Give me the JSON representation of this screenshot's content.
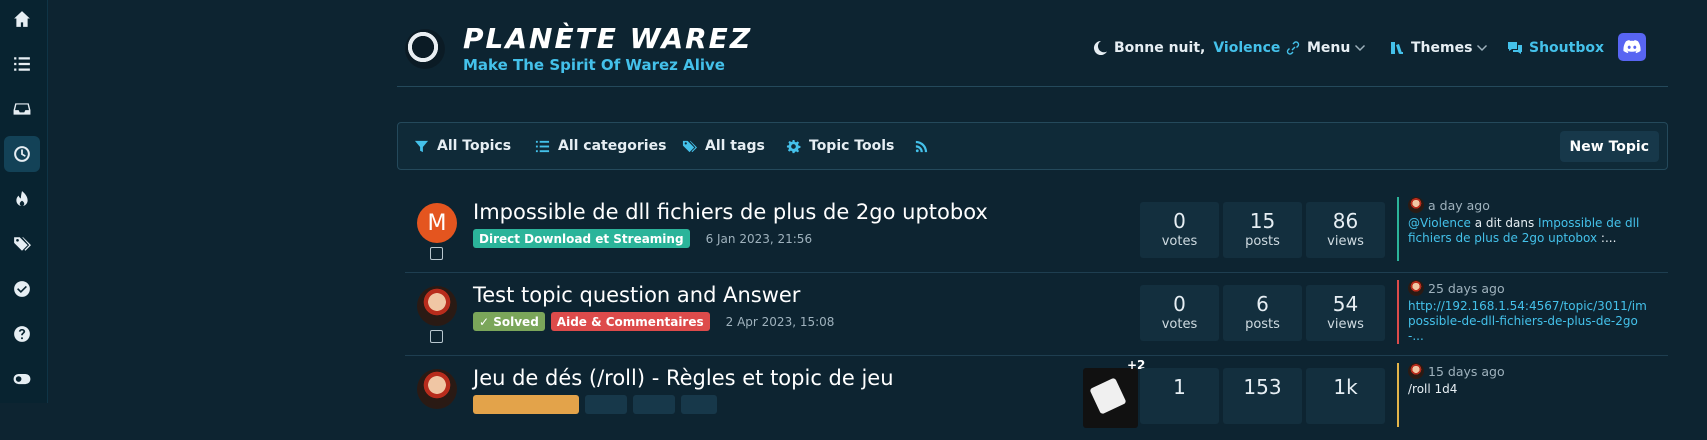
{
  "rail": {
    "items": [
      {
        "icon": "home-icon",
        "active": false
      },
      {
        "icon": "list-icon",
        "active": false
      },
      {
        "icon": "inbox-icon",
        "active": false
      },
      {
        "icon": "clock-icon",
        "active": true
      },
      {
        "icon": "fire-icon",
        "active": false
      },
      {
        "icon": "tags-icon",
        "active": false
      },
      {
        "icon": "check-circle-icon",
        "active": false
      },
      {
        "icon": "help-icon",
        "active": false
      },
      {
        "icon": "toggle-icon",
        "active": false
      }
    ]
  },
  "brand": {
    "title": "PLANÈTE WAREZ",
    "subtitle": "Make The Spirit Of Warez Alive"
  },
  "header": {
    "greeting": "Bonne nuit,",
    "username": "Violence",
    "menu": "Menu",
    "themes": "Themes",
    "shoutbox": "Shoutbox"
  },
  "toolbar": {
    "all_topics": "All Topics",
    "all_categories": "All categories",
    "all_tags": "All tags",
    "topic_tools": "Topic Tools",
    "new_topic": "New Topic"
  },
  "topics": [
    {
      "title": "Impossible de dll fichiers de plus de 2go uptobox",
      "avatar_letter": "M",
      "tags": [
        {
          "label": "Direct Download et Streaming",
          "color": "#2bb49a"
        }
      ],
      "date": "6 Jan 2023, 21:56",
      "votes": "0",
      "posts": "15",
      "views": "86",
      "stat_labels": {
        "votes": "votes",
        "posts": "posts",
        "views": "views"
      },
      "last_ago": "a day ago",
      "last_user": "@Violence",
      "last_mid": " a dit dans ",
      "last_link": "Impossible de dll fichiers de plus de 2go uptobox",
      "last_tail": " :...",
      "border": "#2bb49a"
    },
    {
      "title": "Test topic question and Answer",
      "tags": [
        {
          "label": "✓ Solved",
          "color": "#7ba65a"
        },
        {
          "label": "Aide & Commentaires",
          "color": "#dd4b4b"
        }
      ],
      "date": "2 Apr 2023, 15:08",
      "votes": "0",
      "posts": "6",
      "views": "54",
      "last_ago": "25 days ago",
      "last_link": "http://192.168.1.54:4567/topic/3011/impossible-de-dll-fichiers-de-plus-de-2go-...",
      "border": "#dd4b4b"
    },
    {
      "title": "Jeu de dés (/roll) - Règles et topic de jeu",
      "thumb_extra": "+2",
      "votes": "1",
      "posts": "153",
      "views": "1k",
      "last_ago": "15 days ago",
      "last_text": "/roll 1d4",
      "border": "#e3b54a"
    }
  ]
}
